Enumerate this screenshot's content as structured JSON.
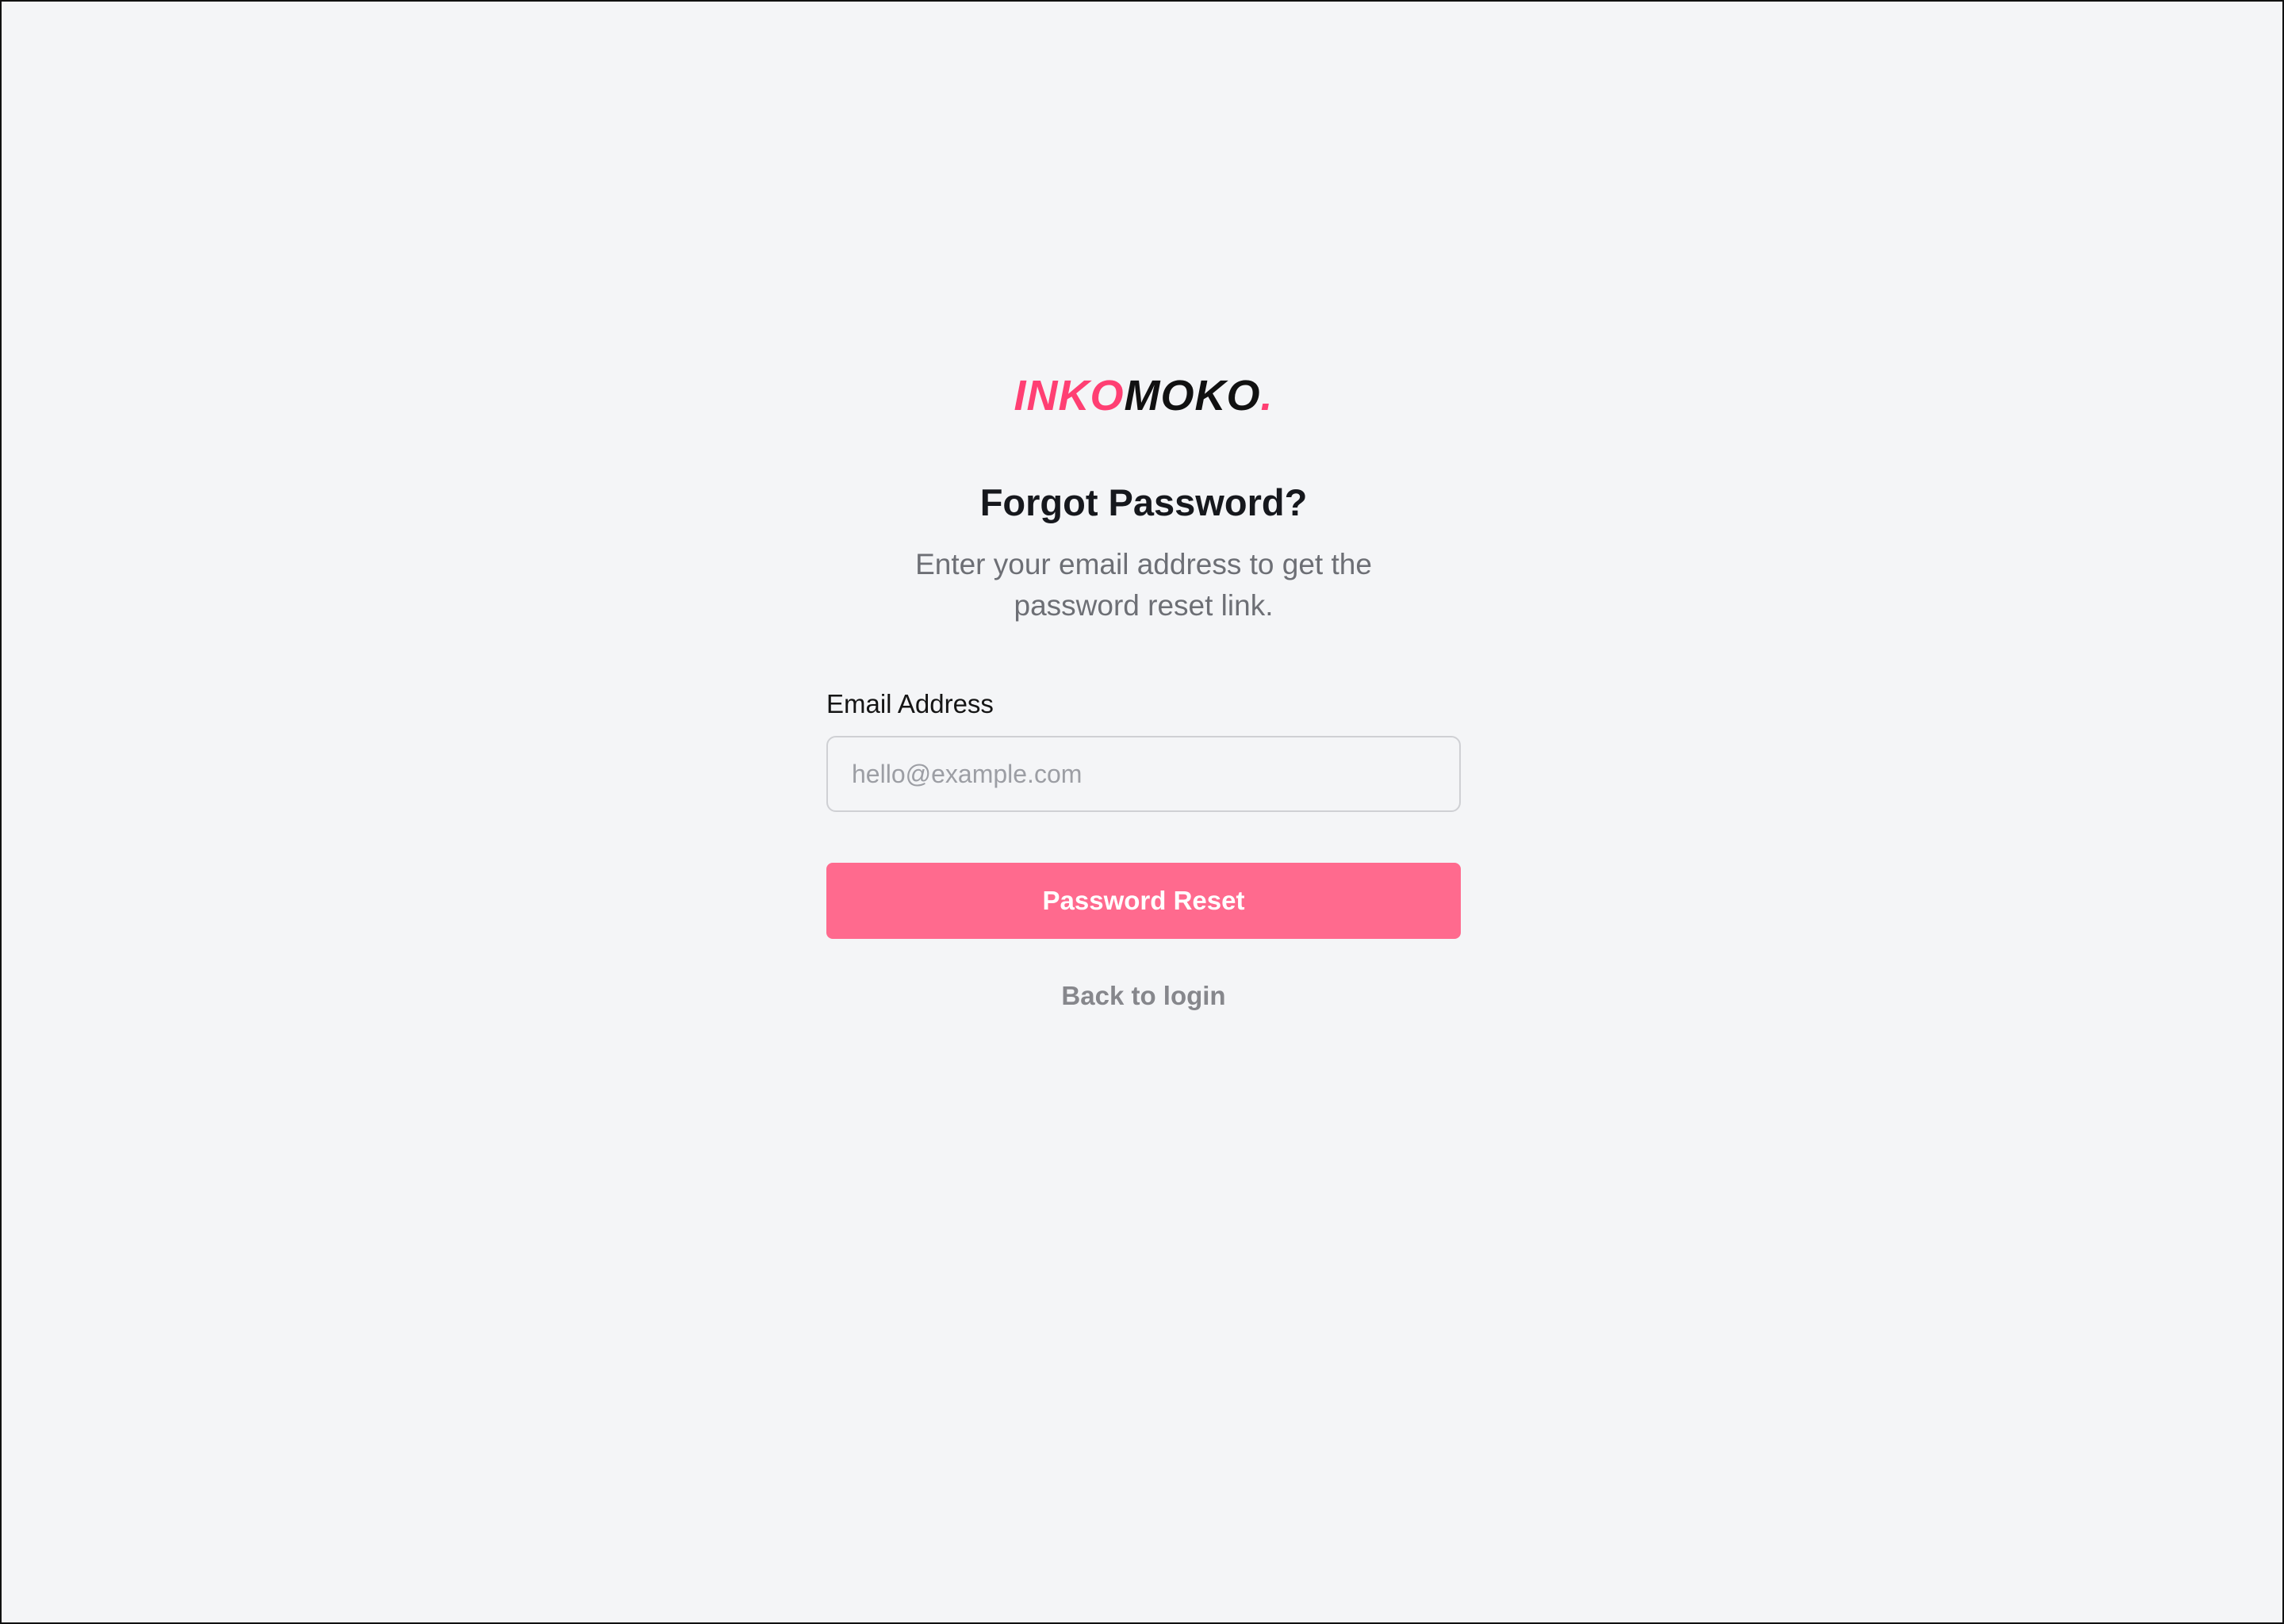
{
  "brand": {
    "part1": "INKO",
    "part2": "MOKO",
    "dot": ".",
    "accent_color": "#ff3f73"
  },
  "header": {
    "title": "Forgot Password?",
    "subtitle": "Enter your email address to get the password reset link."
  },
  "form": {
    "email_label": "Email Address",
    "email_placeholder": "hello@example.com",
    "email_value": "",
    "submit_label": "Password Reset",
    "submit_color": "#ff6a8e"
  },
  "footer": {
    "back_link_label": "Back to login"
  }
}
